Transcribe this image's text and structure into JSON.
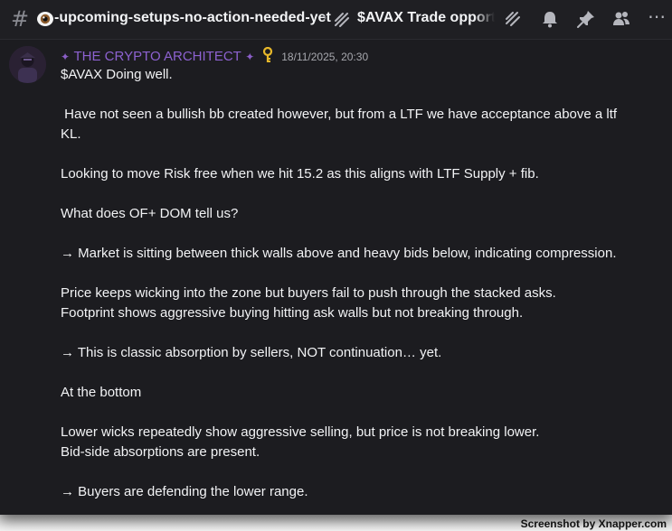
{
  "header": {
    "channel_name": "-upcoming-setups-no-action-needed-yet",
    "breadcrumb_separator": "›",
    "thread_name": "$AVAX Trade opportu",
    "more_label": "⋯"
  },
  "message": {
    "author": "THE CRYPTO ARCHITECT",
    "timestamp": "18/11/2025, 20:30",
    "lines": [
      "$AVAX Doing well.",
      "",
      " Have not seen a bullish bb created however, but from a LTF we have acceptance above a ltf",
      "KL.",
      "",
      "Looking to move Risk free when we hit 15.2 as this aligns with LTF Supply + fib.",
      "",
      "What does OF+ DOM tell us?",
      "",
      "→ Market is sitting between thick walls above and heavy bids below, indicating compression.",
      "",
      "Price keeps wicking into the zone but buyers fail to push through the stacked asks.",
      "Footprint shows aggressive buying hitting ask walls but not breaking through.",
      "",
      "→ This is classic absorption by sellers, NOT continuation… yet.",
      "",
      "At the bottom",
      "",
      "Lower wicks repeatedly show aggressive selling, but price is not breaking lower.",
      "Bid-side absorptions are present.",
      "",
      "→ Buyers are defending the lower range."
    ]
  },
  "footer": {
    "credit": "Screenshot by Xnapper.com"
  },
  "colors": {
    "background": "#1c1c20",
    "author": "#8d62d1",
    "key": "#e8b82a",
    "text": "#f2f3f5",
    "muted": "#a7a8ae"
  }
}
